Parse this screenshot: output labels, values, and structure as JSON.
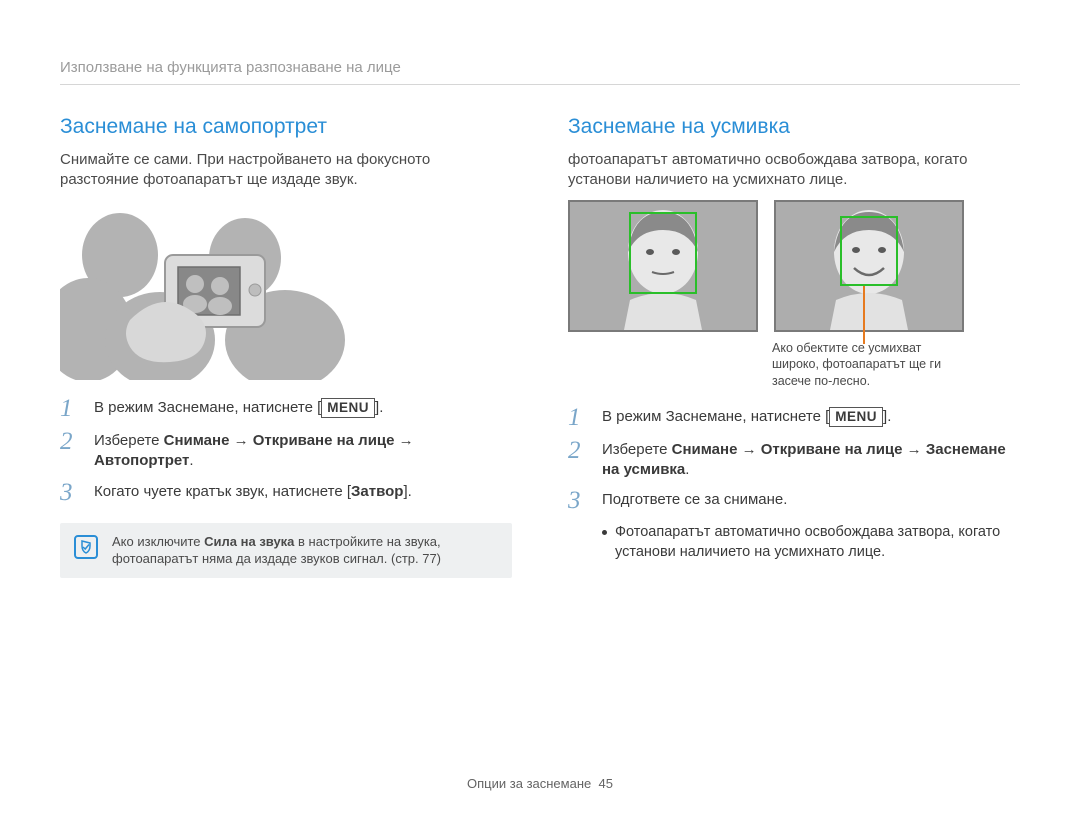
{
  "breadcrumb": "Използване на функцията разпознаване на лице",
  "left": {
    "title": "Заснемане на самопортрет",
    "intro": "Снимайте се сами. При настройването на фокусното разстояние фотоапаратът ще издаде звук.",
    "steps": [
      {
        "num": "1",
        "pre": "В режим Заснемане, натиснете [",
        "key": "MENU",
        "post": "]."
      },
      {
        "num": "2",
        "text_html": "Изберете <b>Снимане</b> &rarr; <b>Откриване на лице</b> &rarr; <b>Автопортрет</b>."
      },
      {
        "num": "3",
        "text_html": "Когато чуете кратък звук, натиснете [<b>Затвор</b>]."
      }
    ],
    "note": "Ако изключите <b>Сила на звука</b> в настройките на звука, фотоапаратът няма да издаде звуков сигнал. (стр. 77)"
  },
  "right": {
    "title": "Заснемане на усмивка",
    "intro": "фотоапаратът автоматично освобождава затвора, когато установи наличието на усмихнато лице.",
    "smile_note": "Ако обектите се усмихват широко, фотоапаратът ще ги засече по-лесно.",
    "steps": [
      {
        "num": "1",
        "pre": "В режим Заснемане, натиснете [",
        "key": "MENU",
        "post": "]."
      },
      {
        "num": "2",
        "text_html": "Изберете <b>Снимане</b> &rarr; <b>Откриване на лице</b> &rarr; <b>Заснемане на усмивка</b>."
      },
      {
        "num": "3",
        "text_html": "Подгответе се за снимане."
      }
    ],
    "sub_bullet": "Фотоапаратът автоматично освобождава затвора, когато установи наличието на усмихнато лице."
  },
  "footer": {
    "label": "Опции за заснемане",
    "page": "45"
  }
}
